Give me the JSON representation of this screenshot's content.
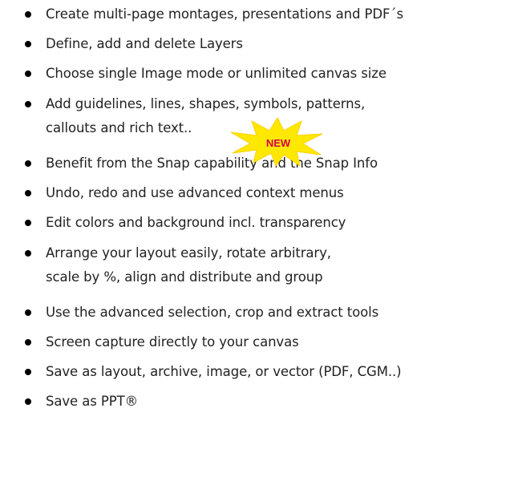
{
  "features": [
    {
      "lines": [
        "Create multi-page montages, presentations and PDF´s"
      ]
    },
    {
      "lines": [
        "Define, add and delete Layers"
      ]
    },
    {
      "lines": [
        "Choose single Image mode or unlimited canvas size"
      ]
    },
    {
      "lines": [
        "Add guidelines, lines, shapes, symbols, patterns,",
        "callouts and rich text.."
      ]
    },
    {
      "lines": [
        "Benefit from the Snap capability and the Snap Info"
      ]
    },
    {
      "lines": [
        "Undo, redo and use advanced context menus"
      ]
    },
    {
      "lines": [
        "Edit colors and background incl. transparency"
      ]
    },
    {
      "lines": [
        "Arrange your layout easily, rotate arbitrary,",
        "scale by %, align and distribute and group"
      ]
    },
    {
      "lines": [
        "Use the advanced selection, crop and extract tools"
      ]
    },
    {
      "lines": [
        "Screen capture directly to your canvas"
      ]
    },
    {
      "lines": [
        "Save as layout, archive, image, or vector (PDF, CGM..)"
      ]
    },
    {
      "lines": [
        "Save as PPT®"
      ]
    }
  ],
  "badge": {
    "text": "NEW",
    "fill": "#ffe800",
    "text_color": "#d4004a",
    "icon": "starburst-icon"
  }
}
